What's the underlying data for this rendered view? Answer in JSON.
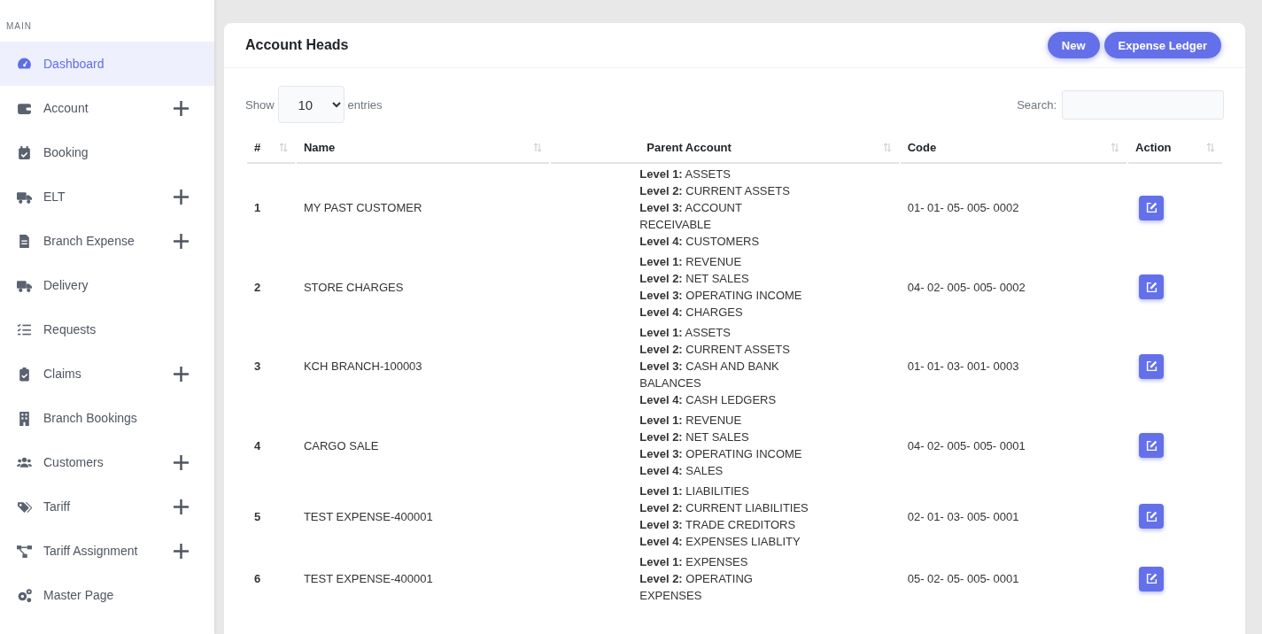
{
  "sidebar": {
    "section": "MAIN",
    "items": [
      {
        "label": "Dashboard",
        "expandable": false,
        "selected": true
      },
      {
        "label": "Account",
        "expandable": true,
        "selected": false
      },
      {
        "label": "Booking",
        "expandable": false,
        "selected": false
      },
      {
        "label": "ELT",
        "expandable": true,
        "selected": false
      },
      {
        "label": "Branch Expense",
        "expandable": true,
        "selected": false
      },
      {
        "label": "Delivery",
        "expandable": false,
        "selected": false
      },
      {
        "label": "Requests",
        "expandable": false,
        "selected": false
      },
      {
        "label": "Claims",
        "expandable": true,
        "selected": false
      },
      {
        "label": "Branch Bookings",
        "expandable": false,
        "selected": false
      },
      {
        "label": "Customers",
        "expandable": true,
        "selected": false
      },
      {
        "label": "Tariff",
        "expandable": true,
        "selected": false
      },
      {
        "label": "Tariff Assignment",
        "expandable": true,
        "selected": false
      },
      {
        "label": "Master Page",
        "expandable": false,
        "selected": false
      }
    ]
  },
  "card": {
    "title": "Account Heads",
    "buttons": [
      "New",
      "Expense Ledger"
    ],
    "length_label_before": "Show",
    "length_value": "10",
    "length_label_after": "entries",
    "search_label": "Search:"
  },
  "table": {
    "columns": [
      "#",
      "Name",
      "Parent Account",
      "Code",
      "Action"
    ],
    "rows": [
      {
        "number": "1",
        "name": "MY PAST CUSTOMER",
        "parent": [
          "**Level 1:** ASSETS",
          "**Level 2:** CURRENT ASSETS",
          "**Level 3:** ACCOUNT RECEIVABLE",
          "**Level 4:** CUSTOMERS"
        ],
        "code": "01- 01- 05- 005- 0002"
      },
      {
        "number": "2",
        "name": "STORE CHARGES",
        "parent": [
          "**Level 1:** REVENUE",
          "**Level 2:** NET SALES",
          "**Level 3:** OPERATING INCOME",
          "**Level 4:** CHARGES"
        ],
        "code": "04- 02- 005- 005- 0002"
      },
      {
        "number": "3",
        "name": "KCH BRANCH-100003",
        "parent": [
          "**Level 1:** ASSETS",
          "**Level 2:** CURRENT ASSETS",
          "**Level 3:** CASH AND BANK BALANCES",
          "**Level 4:** CASH LEDGERS"
        ],
        "code": "01- 01- 03- 001- 0003"
      },
      {
        "number": "4",
        "name": "CARGO SALE",
        "parent": [
          "**Level 1:** REVENUE",
          "**Level 2:** NET SALES",
          "**Level 3:** OPERATING INCOME",
          "**Level 4:** SALES"
        ],
        "code": "04- 02- 005- 005- 0001"
      },
      {
        "number": "5",
        "name": "TEST EXPENSE-400001",
        "parent": [
          "**Level 1:** LIABILITIES",
          "**Level 2:** CURRENT LIABILITIES",
          "**Level 3:** TRADE CREDITORS",
          "**Level 4:** EXPENSES LIABLITY"
        ],
        "code": "02- 01- 03- 005- 0001"
      },
      {
        "number": "6",
        "name": "TEST EXPENSE-400001",
        "parent": [
          "**Level 1:** EXPENSES",
          "**Level 2:** OPERATING EXPENSES"
        ],
        "code": "05- 02- 05- 005- 0001"
      }
    ]
  }
}
